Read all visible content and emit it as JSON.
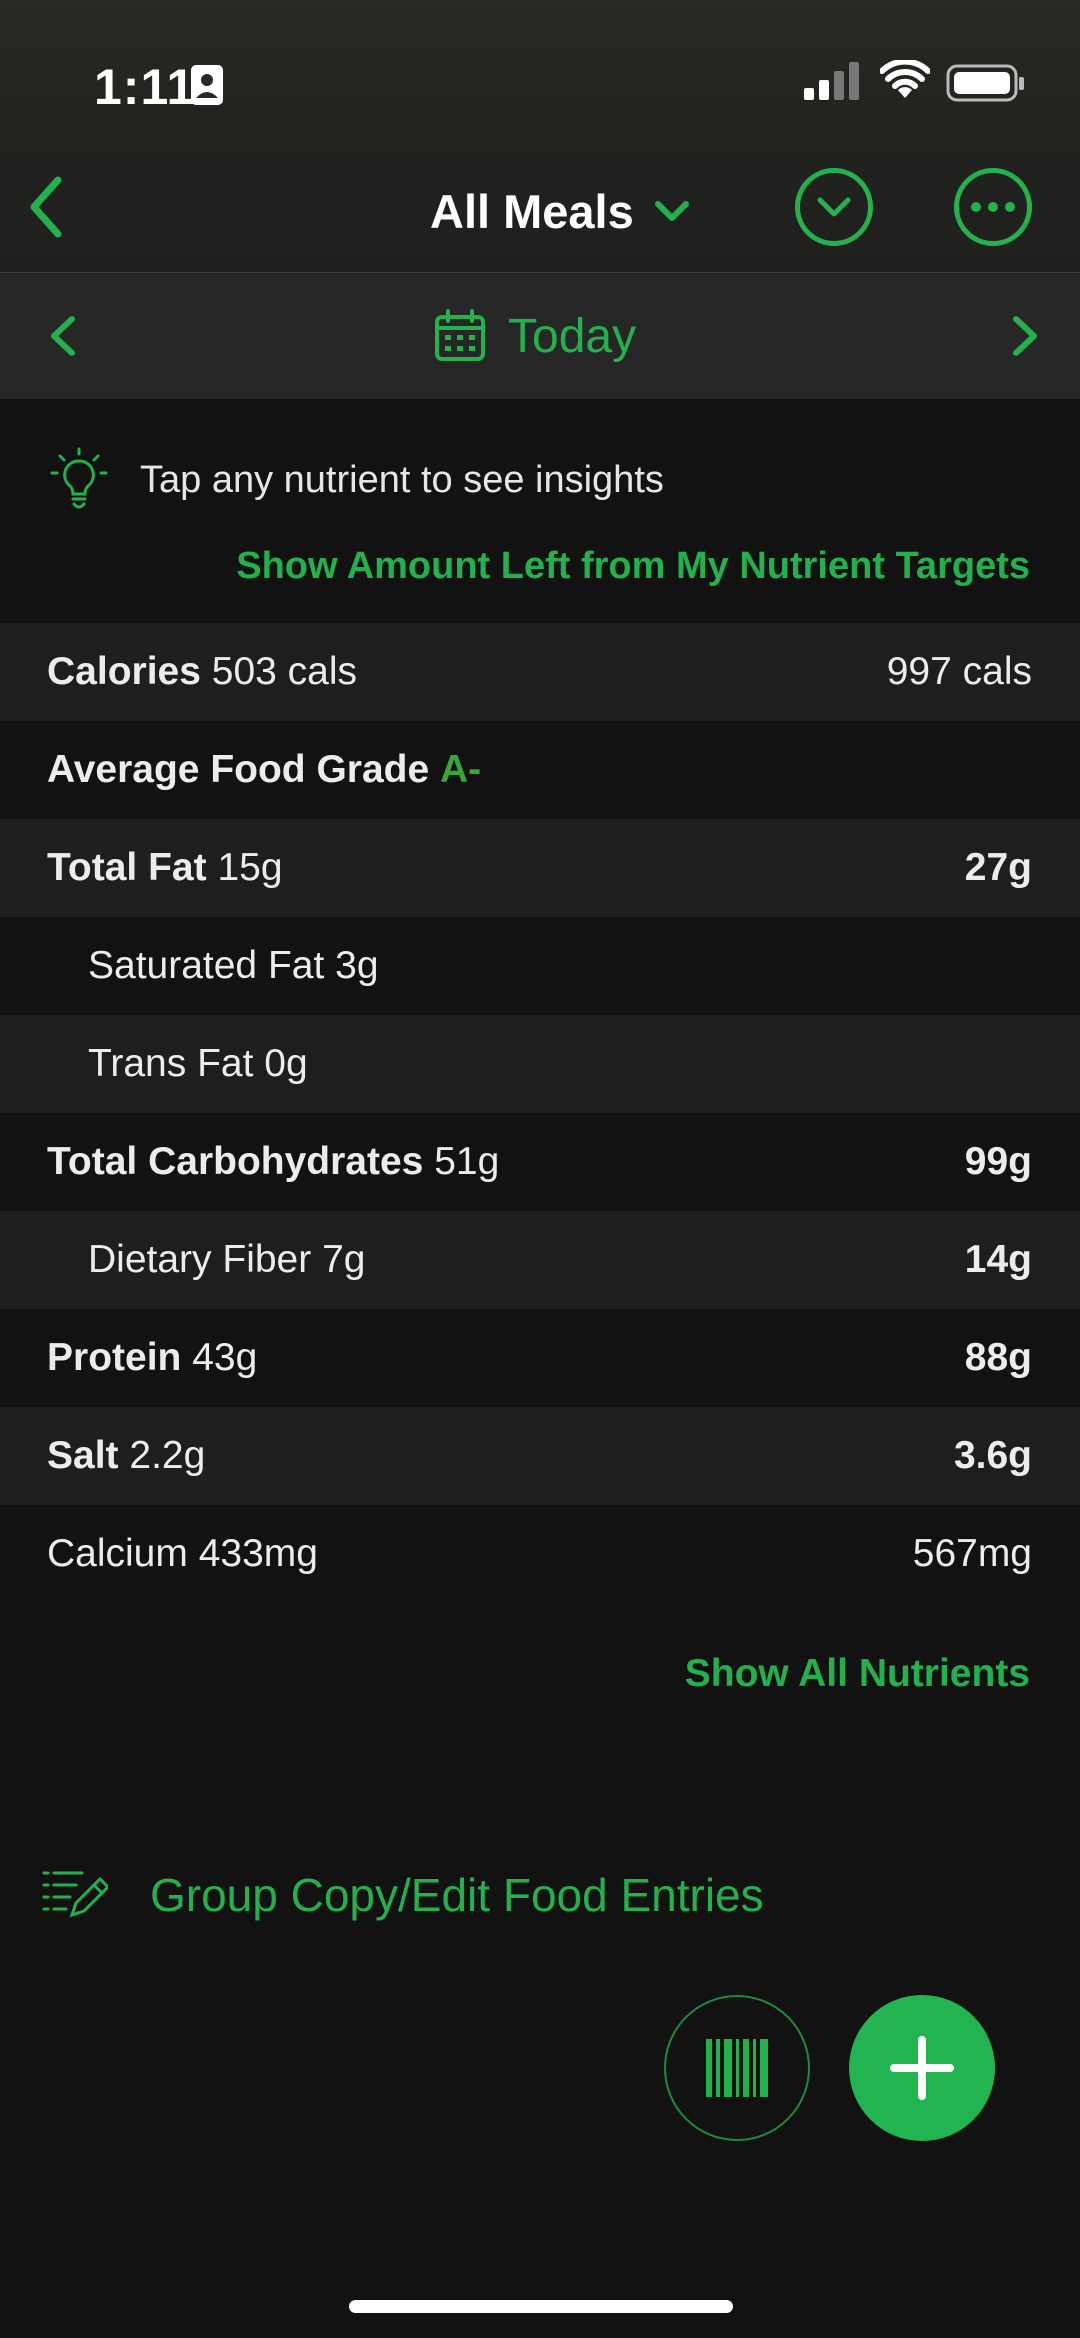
{
  "status_bar": {
    "time": "1:11"
  },
  "nav": {
    "title": "All Meals"
  },
  "date_bar": {
    "label": "Today"
  },
  "insight": {
    "hint": "Tap any nutrient to see insights",
    "targets_link": "Show Amount Left from My Nutrient Targets"
  },
  "nutrients": [
    {
      "name": "Calories",
      "amount": "503 cals",
      "remaining": "997 cals"
    },
    {
      "name": "Average Food Grade",
      "grade": "A-"
    },
    {
      "name": "Total Fat",
      "amount": "15g",
      "remaining": "27g"
    },
    {
      "name": "Saturated Fat",
      "amount": "3g"
    },
    {
      "name": "Trans Fat",
      "amount": "0g"
    },
    {
      "name": "Total Carbohydrates",
      "amount": "51g",
      "remaining": "99g"
    },
    {
      "name": "Dietary Fiber",
      "amount": "7g",
      "remaining": "14g"
    },
    {
      "name": "Protein",
      "amount": "43g",
      "remaining": "88g"
    },
    {
      "name": "Salt",
      "amount": "2.2g",
      "remaining": "3.6g"
    },
    {
      "name": "Calcium",
      "amount": "433mg",
      "remaining": "567mg"
    }
  ],
  "show_all": "Show All Nutrients",
  "group_edit": "Group Copy/Edit Food Entries",
  "colors": {
    "accent": "#22b14c",
    "grade": "#3aa63a",
    "background": "#121212",
    "row_alt": "#1e1e20"
  },
  "icons": [
    "id-card-icon",
    "signal-icon",
    "wifi-icon",
    "battery-icon",
    "back-chevron-icon",
    "chevron-down-icon",
    "collapse-icon",
    "more-icon",
    "calendar-icon",
    "lightbulb-icon",
    "edit-list-icon",
    "barcode-icon",
    "plus-icon"
  ]
}
